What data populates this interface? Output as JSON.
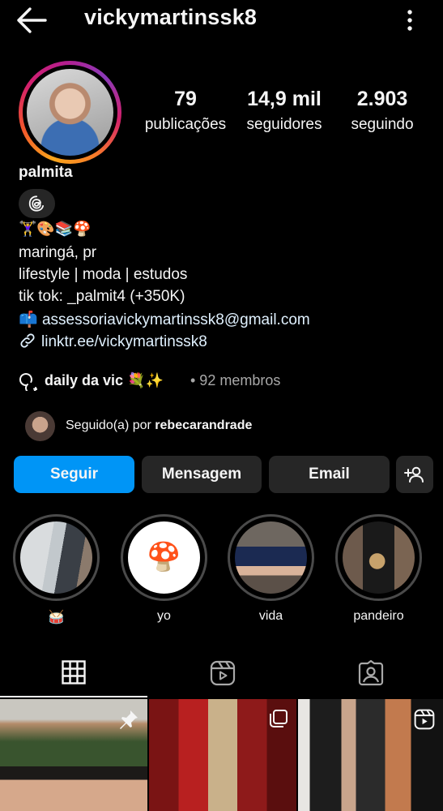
{
  "header": {
    "username": "vickymartinssk8",
    "back_icon": "arrow-left-icon",
    "more_icon": "kebab-vertical-icon"
  },
  "profile": {
    "display_name": "palmita",
    "stats": [
      {
        "value": "79",
        "label": "publicações"
      },
      {
        "value": "14,9 mil",
        "label": "seguidores"
      },
      {
        "value": "2.903",
        "label": "seguindo"
      }
    ],
    "threads_icon": "threads-icon",
    "bio": {
      "emoji_line": "🏋️‍♀️🎨📚🍄",
      "location": "maringá, pr",
      "tagline": "lifestyle | moda | estudos",
      "tiktok": "tik tok: _palmit4 (+350K)",
      "email_icon": "📫",
      "email": "assessoriavickymartinssk8@gmail.com",
      "link": "linktr.ee/vickymartinssk8"
    },
    "channel": {
      "name": "daily da vic 💐✨",
      "members": "• 92 membros"
    },
    "followed_by": {
      "prefix": "Seguido(a) por",
      "user": "rebecarandrade"
    }
  },
  "actions": {
    "follow": "Seguir",
    "message": "Mensagem",
    "email": "Email",
    "suggest_icon": "add-person-icon"
  },
  "highlights": [
    {
      "label": "🥁"
    },
    {
      "label": "yo",
      "emoji": "🍄"
    },
    {
      "label": "vida"
    },
    {
      "label": "pandeiro"
    }
  ],
  "tabs": [
    "grid-icon",
    "reels-icon",
    "tagged-icon"
  ],
  "colors": {
    "accent": "#0095f6",
    "button_bg": "#262626",
    "background": "#000000",
    "muted_text": "#a8a8a8"
  }
}
